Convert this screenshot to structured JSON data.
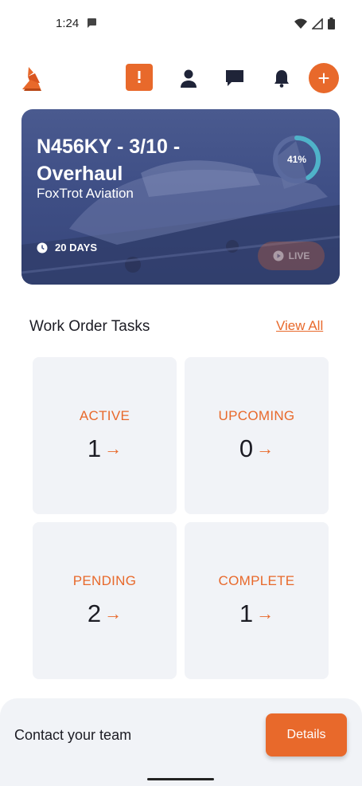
{
  "status_bar": {
    "time": "1:24"
  },
  "header": {
    "icons": [
      "logo-fox-icon",
      "alert-icon",
      "user-icon",
      "chat-icon",
      "bell-icon",
      "add-icon"
    ],
    "add_symbol": "+"
  },
  "hero": {
    "title": "N456KY - 3/10 - Overhaul",
    "subtitle": "FoxTrot Aviation",
    "progress_label": "41%",
    "progress_value": 0.41,
    "days_label": "20 DAYS",
    "live_label": "LIVE"
  },
  "tasks": {
    "title": "Work Order Tasks",
    "view_all": "View All",
    "cards": [
      {
        "label": "ACTIVE",
        "count": "1"
      },
      {
        "label": "UPCOMING",
        "count": "0"
      },
      {
        "label": "PENDING",
        "count": "2"
      },
      {
        "label": "COMPLETE",
        "count": "1"
      }
    ],
    "arrow": "→"
  },
  "footer": {
    "contact_text": "Contact your team",
    "details_label": "Details"
  },
  "colors": {
    "accent": "#e8692b",
    "card_bg": "#f1f3f7",
    "hero_bg": "#3f4f86"
  }
}
